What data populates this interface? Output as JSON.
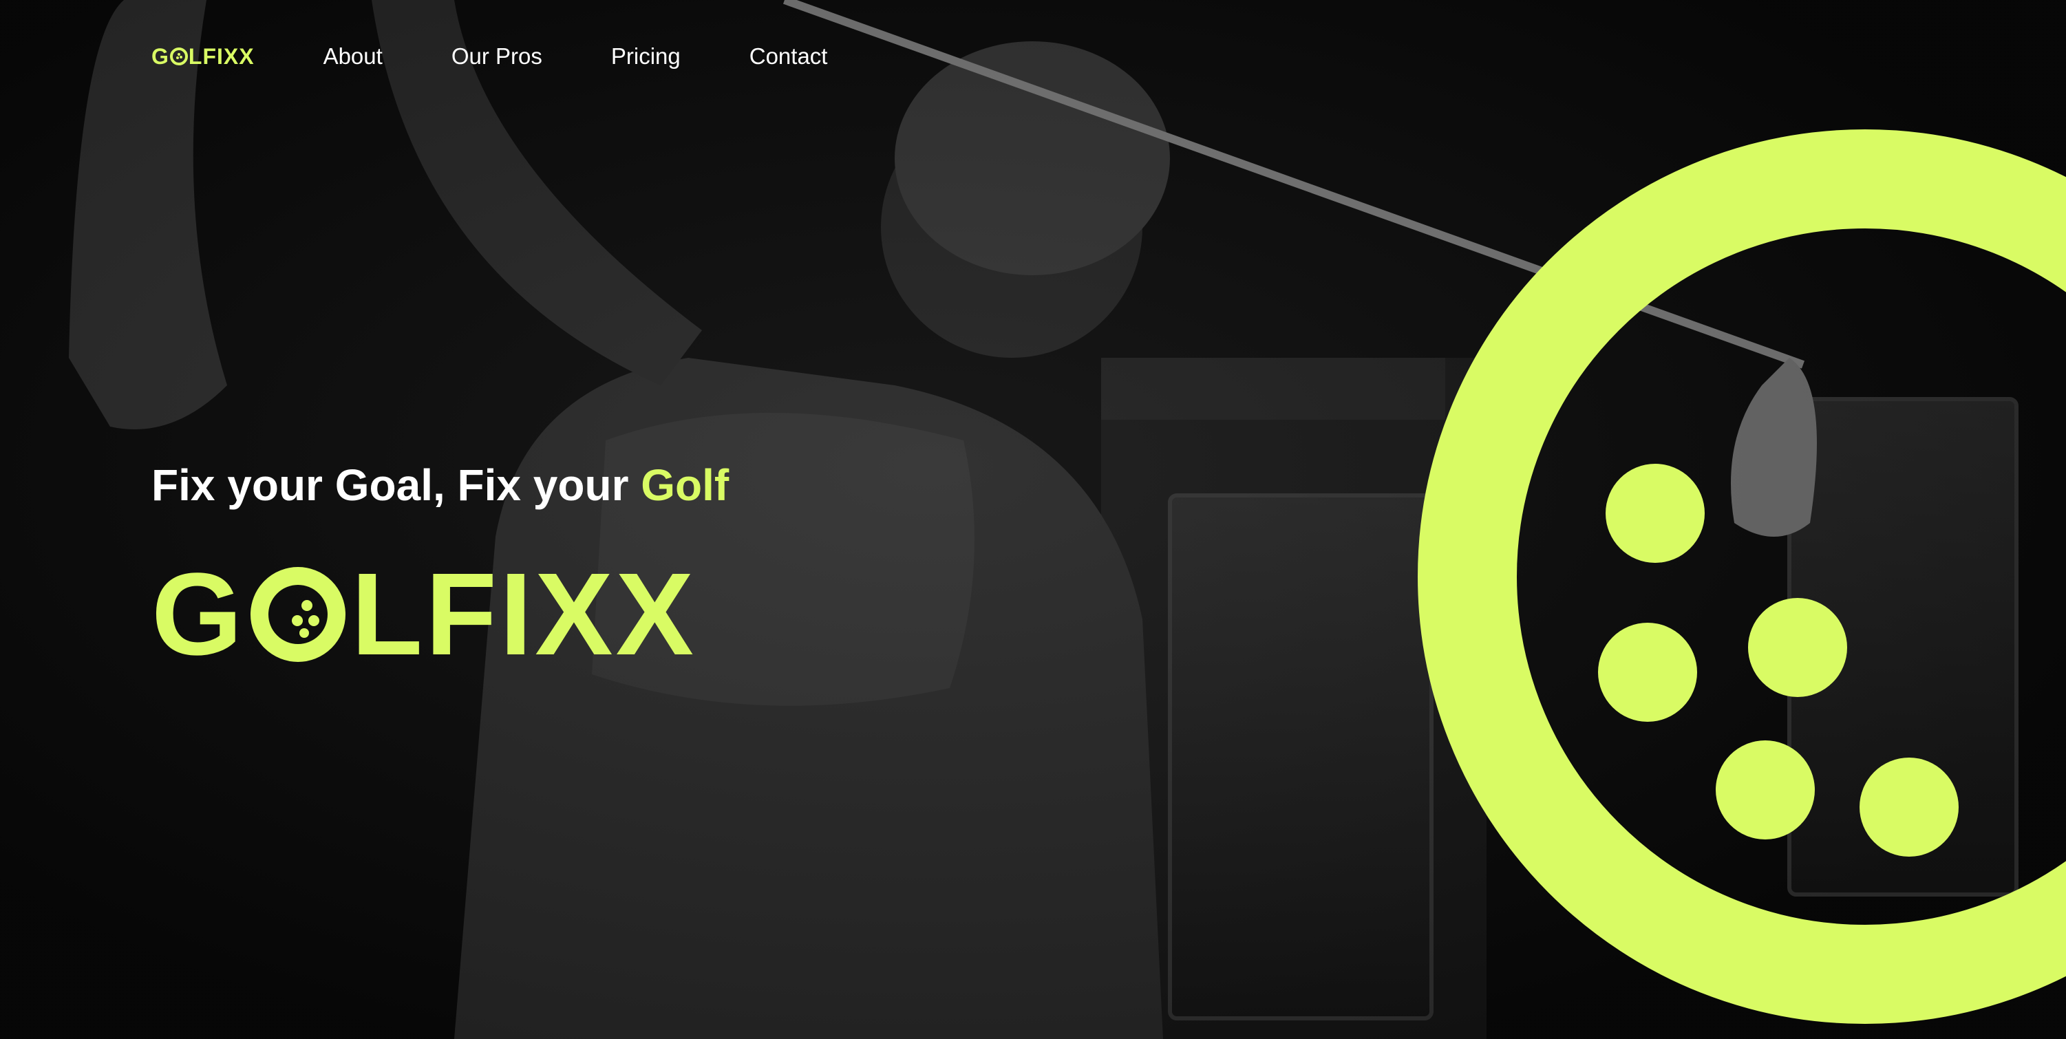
{
  "brand": {
    "logo_text_before": "G",
    "logo_text_after": "LFIXX",
    "accent_color": "#d9fb64"
  },
  "nav": {
    "items": [
      {
        "label": "About"
      },
      {
        "label": "Our Pros"
      },
      {
        "label": "Pricing"
      },
      {
        "label": "Contact"
      }
    ]
  },
  "hero": {
    "tagline_main": "Fix your Goal, Fix your ",
    "tagline_accent": "Golf",
    "wordmark_before": "G",
    "wordmark_after": "LFIXX"
  },
  "icons": {
    "logo_o": "golf-ball-icon",
    "brand_mark": "golf-ball-ring-icon"
  }
}
